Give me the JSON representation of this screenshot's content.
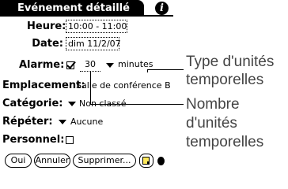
{
  "title": "Evénement détaillé",
  "info_glyph": "i",
  "fields": {
    "heure": {
      "label": "Heure:",
      "value": "10:00 - 11:00"
    },
    "date": {
      "label": "Date:",
      "value": "dim 11/2/07"
    },
    "alarme": {
      "label": "Alarme:",
      "checked": true,
      "amount": "30",
      "unit": "minutes"
    },
    "emplacement": {
      "label": "Emplacement:",
      "value": "Salle de conférence B"
    },
    "categorie": {
      "label": "Catégorie:",
      "value": "Non classé"
    },
    "repeter": {
      "label": "Répéter:",
      "value": "Aucune"
    },
    "personnel": {
      "label": "Personnel:",
      "checked": false
    }
  },
  "buttons": {
    "ok": "Oui",
    "cancel": "Annuler",
    "delete": "Supprimer..."
  },
  "callouts": {
    "unit_type": [
      "Type d'unités",
      "temporelles"
    ],
    "unit_count": [
      "Nombre",
      "d'unités",
      "temporelles"
    ]
  },
  "icons": {
    "info": "info-icon",
    "note": "note-icon",
    "checkbox_checked": "check-icon",
    "dropdown": "dropdown-triangle-icon"
  },
  "colors": {
    "title_bg": "#000000",
    "title_fg": "#ffffff",
    "note_fill": "#ffe95c",
    "callout_text": "#444444"
  }
}
